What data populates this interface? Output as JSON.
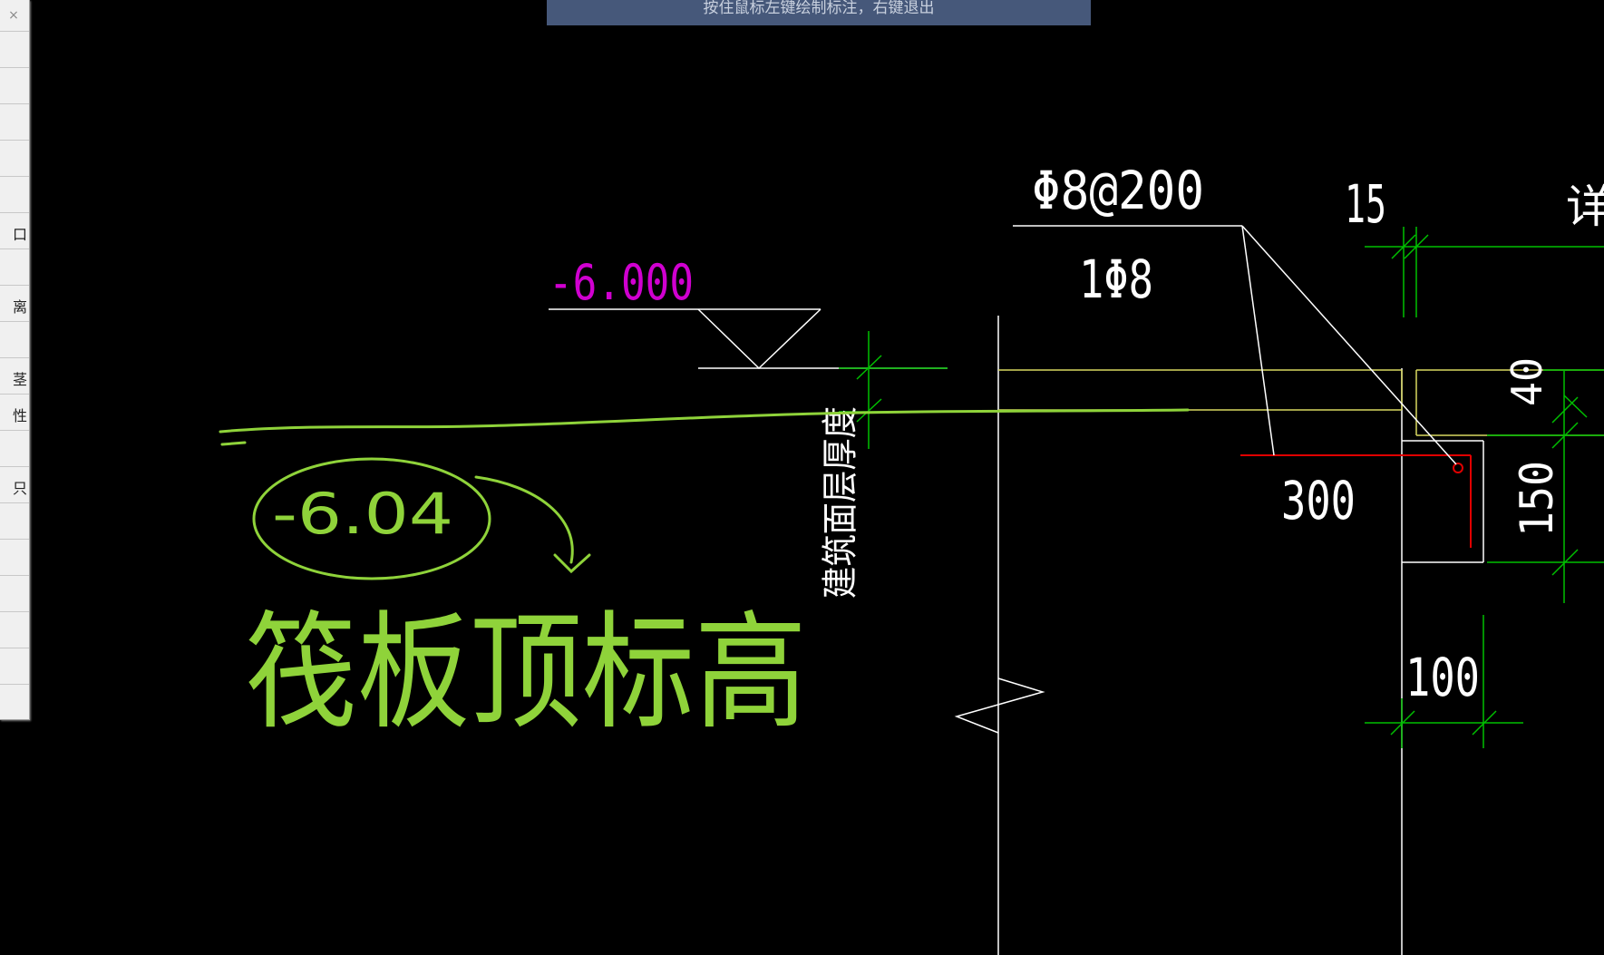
{
  "status_bar": {
    "message": "按住鼠标左键绘制标注，右键退出"
  },
  "side_panel": {
    "close_glyph": "×",
    "rows": [
      "",
      "",
      "",
      "",
      "",
      "口",
      "",
      "离",
      "",
      "茎",
      "性",
      "",
      "只",
      "",
      "",
      "",
      "",
      "",
      ""
    ]
  },
  "drawing": {
    "elevation_label": "-6.000",
    "rebar_label_1": "Φ8@200",
    "rebar_label_2": "1Φ8",
    "dim_300": "300",
    "dim_15": "15",
    "detail_label_partial": "详",
    "dim_40": "40",
    "dim_150": "150",
    "dim_100": "100",
    "layer_label": "建筑面层厚度"
  },
  "markup": {
    "circled_text": "-6.04",
    "handwritten_note": "筏板顶标高"
  },
  "colors": {
    "background": "#000000",
    "white_line": "#ffffff",
    "yellow_line": "#d8d860",
    "green_dim": "#00c000",
    "magenta_text": "#d000d0",
    "red_line": "#e00000",
    "markup_green": "#8fd33a",
    "status_bg": "#46587a"
  }
}
